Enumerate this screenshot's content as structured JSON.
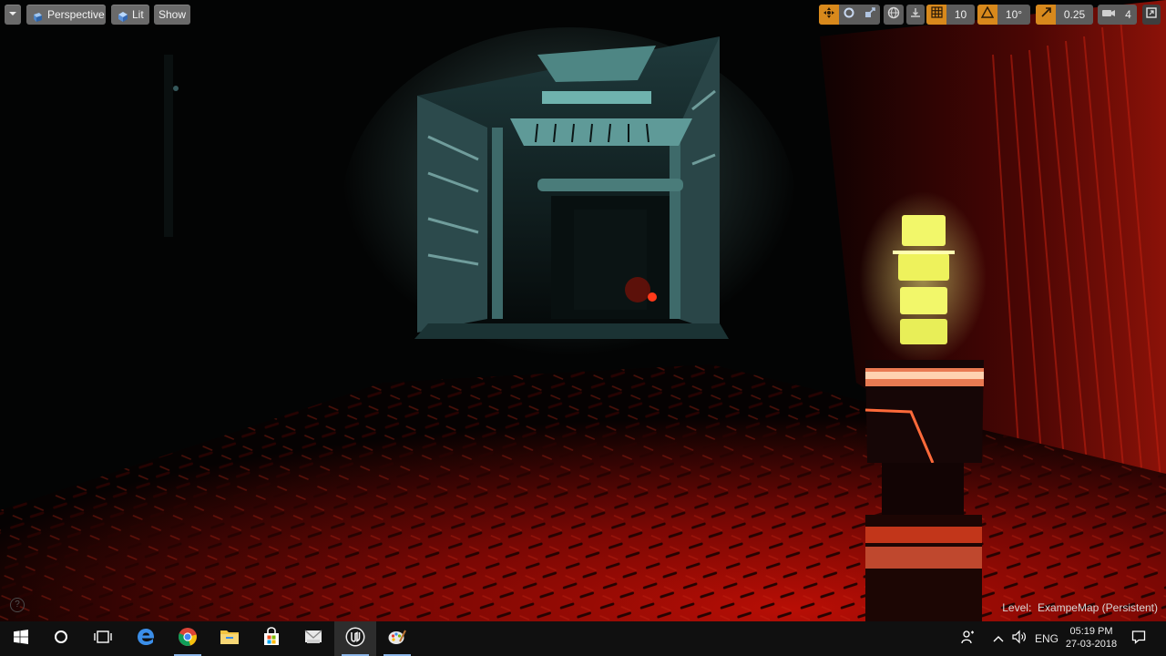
{
  "viewport_toolbar": {
    "menu_icon": "chevron-down-icon",
    "perspective_label": "Perspective",
    "lit_label": "Lit",
    "show_label": "Show"
  },
  "viewport_settings": {
    "grid_snap_value": "10",
    "rotation_snap_value": "10°",
    "scale_snap_value": "0.25",
    "camera_speed_value": "4",
    "accent_color": "#d8891c"
  },
  "status": {
    "level_prefix": "Level:",
    "level_name": "ExampeMap (Persistent)"
  },
  "taskbar": {
    "language": "ENG",
    "time": "05:19 PM",
    "date": "27-03-2018",
    "apps": [
      "start-icon",
      "cortana-icon",
      "task-view-icon",
      "edge-icon",
      "chrome-icon",
      "file-explorer-icon",
      "store-icon",
      "mail-icon",
      "unreal-engine-icon",
      "paint-icon"
    ]
  }
}
